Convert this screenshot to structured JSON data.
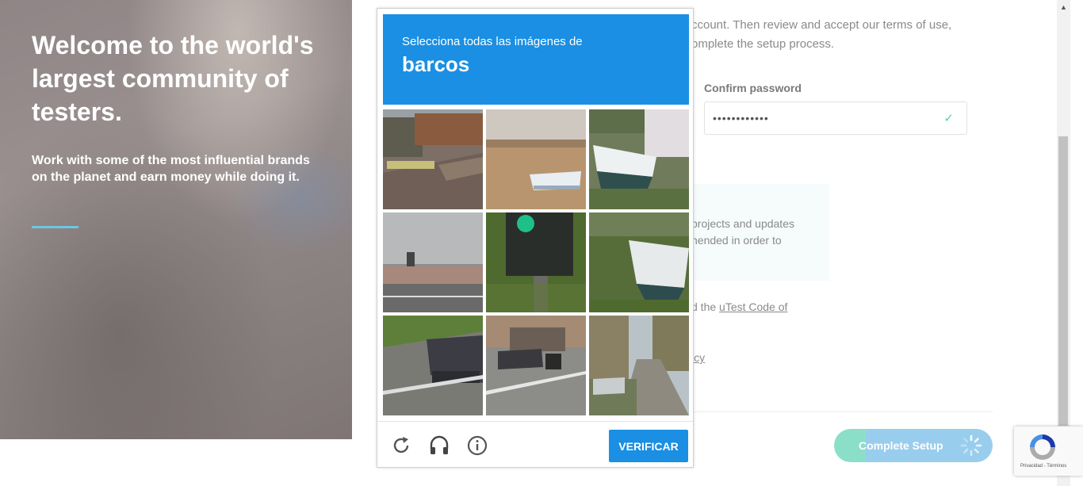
{
  "hero": {
    "title": "Welcome to the world's largest community of testers.",
    "subtitle": "Work with some of the most influential brands on the planet and earn money while doing it."
  },
  "form": {
    "intro": "ccount. Then review and accept our terms of use, omplete the setup process.",
    "confirm_password_label": "Confirm password",
    "confirm_password_value": "••••••••••••",
    "info_text": "projects and updates nended in order to",
    "coc_prefix": "d the ",
    "coc_link": "uTest Code of",
    "policy_fragment": "icy",
    "complete_button": "Complete Setup"
  },
  "captcha": {
    "instruction": "Selecciona todas las imágenes de",
    "target": "barcos",
    "verify_label": "VERIFICAR",
    "tiles": [
      "street-bikes",
      "boat-field",
      "boat-yard",
      "parking-lot",
      "traffic-light",
      "boat-grass",
      "car-parked",
      "car-alley",
      "street-trees"
    ]
  },
  "badge": {
    "terms": "Privacidad - Términos"
  },
  "colors": {
    "captcha_blue": "#1a8fe3",
    "accent_teal": "#6ec6e0",
    "check_green": "#5fcf9a"
  }
}
